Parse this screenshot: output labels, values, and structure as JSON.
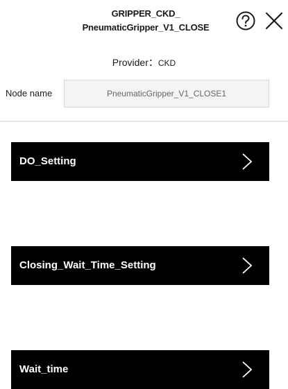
{
  "header": {
    "title_line1": "GRIPPER_CKD_",
    "title_line2": "PneumaticGripper_V1_CLOSE",
    "help_icon": "question-circle-icon",
    "close_icon": "close-x-icon"
  },
  "provider": {
    "label": "Provider：",
    "value": "CKD"
  },
  "node": {
    "label": "Node name",
    "value": "PneumaticGripper_V1_CLOSE1"
  },
  "menu": {
    "items": [
      {
        "label": "DO_Setting"
      },
      {
        "label": "Closing_Wait_Time_Setting"
      },
      {
        "label": "Wait_time"
      }
    ],
    "chevron_icon": "chevron-right-icon",
    "background_color": "#000000",
    "text_color": "#ffffff"
  }
}
